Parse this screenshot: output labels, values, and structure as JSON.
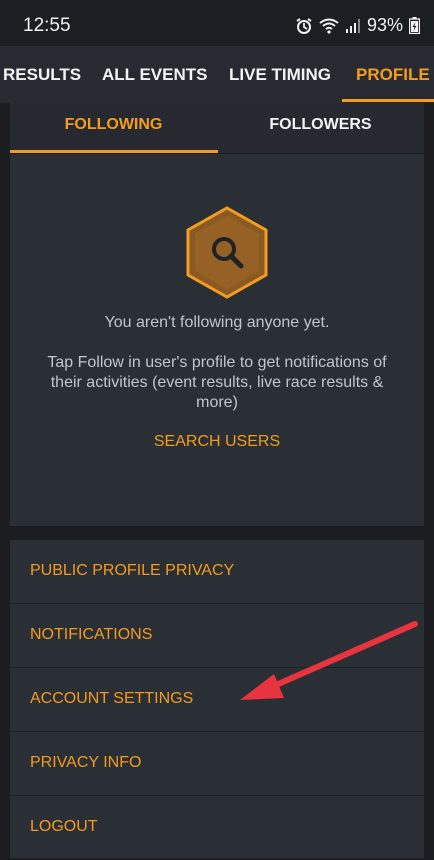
{
  "status": {
    "time": "12:55",
    "battery": "93%"
  },
  "tabs": [
    {
      "label": "RESULTS",
      "active": false
    },
    {
      "label": "ALL EVENTS",
      "active": false
    },
    {
      "label": "LIVE TIMING",
      "active": false
    },
    {
      "label": "PROFILE",
      "active": true
    }
  ],
  "subtabs": [
    {
      "label": "FOLLOWING",
      "active": true
    },
    {
      "label": "FOLLOWERS",
      "active": false
    }
  ],
  "empty_state": {
    "icon": "search-icon",
    "title": "You aren't following anyone yet.",
    "description": "Tap Follow in user's profile to get notifications of their activities (event results, live race results & more)",
    "action": "SEARCH USERS"
  },
  "menu": [
    {
      "label": "PUBLIC PROFILE PRIVACY"
    },
    {
      "label": "NOTIFICATIONS"
    },
    {
      "label": "ACCOUNT SETTINGS"
    },
    {
      "label": "PRIVACY INFO"
    },
    {
      "label": "LOGOUT"
    }
  ],
  "colors": {
    "accent": "#f39c1f",
    "annotation_arrow": "#e8343f"
  }
}
